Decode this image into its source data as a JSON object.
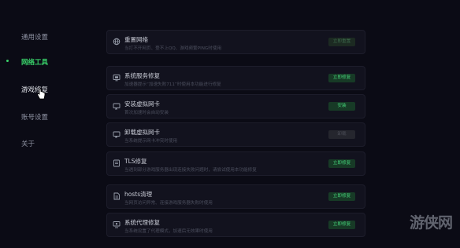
{
  "sidebar": {
    "items": [
      {
        "label": "通用设置"
      },
      {
        "label": "网络工具"
      },
      {
        "label": "游戏修复"
      },
      {
        "label": "账号设置"
      },
      {
        "label": "关于"
      }
    ],
    "active_index": 1,
    "hover_index": 2
  },
  "tools": [
    {
      "title": "重置网络",
      "desc": "当打不开网页、登不上QQ、游戏频繁PING时使用",
      "button": "立即重置",
      "button_state": "dim",
      "icon": "globe-icon"
    },
    {
      "title": "系统服务修复",
      "desc": "加速器提示“加速失败711”时使用本功能进行修复",
      "button": "立即修复",
      "button_state": "active",
      "icon": "service-icon"
    },
    {
      "title": "安装虚拟网卡",
      "desc": "首次加速时会自动安装",
      "button": "安装",
      "button_state": "active",
      "icon": "adapter-icon"
    },
    {
      "title": "卸载虚拟网卡",
      "desc": "当系统提示网卡冲突时使用",
      "button": "卸载",
      "button_state": "disabled",
      "icon": "adapter-icon"
    },
    {
      "title": "TLS修复",
      "desc": "当遇到部分游戏服务器出现连接失败问题时，请尝试使用本功能修复",
      "button": "立即修复",
      "button_state": "active",
      "icon": "tls-icon"
    },
    {
      "title": "hosts清理",
      "desc": "当网页访问异常、连接游戏服务器失败时使用",
      "button": "立即修复",
      "button_state": "active",
      "icon": "hosts-icon"
    },
    {
      "title": "系统代理修复",
      "desc": "当系统设置了代理模式，加速后无效果时使用",
      "button": "立即修复",
      "button_state": "active",
      "icon": "proxy-icon"
    }
  ],
  "watermark": {
    "text": "游侠网"
  },
  "colors": {
    "accent": "#39d36a",
    "background": "#0b0b15",
    "card": "#12121e"
  }
}
